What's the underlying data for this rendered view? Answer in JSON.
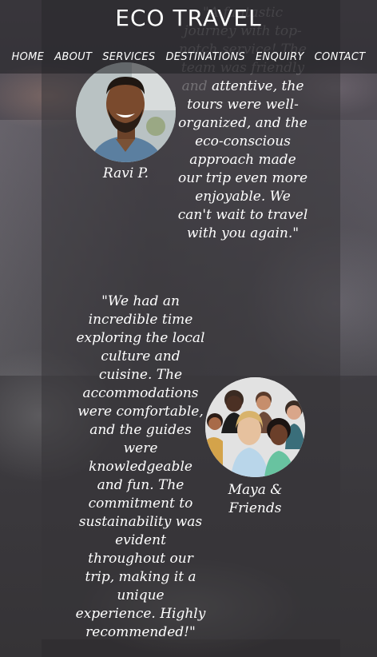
{
  "header": {
    "brand": "ECO TRAVEL",
    "nav": [
      "HOME",
      "ABOUT",
      "SERVICES",
      "DESTINATIONS",
      "ENQUIRY",
      "CONTACT"
    ]
  },
  "testimonials": [
    {
      "hidden_lines": "\"A fantastic journey with top-notch service! The team was friendly and",
      "text": "attentive, the tours were well-organized, and the eco-conscious approach made our trip even more enjoyable. We can't wait to travel with you again.\"",
      "name": "Ravi P.",
      "avatar_icon": "person-photo-icon"
    },
    {
      "text": "\"We had an incredible time exploring the local culture and cuisine. The accommodations were comfortable, and the guides were knowledgeable and fun. The commitment to sustainability was evident throughout our trip, making it a unique experience. Highly recommended!\"",
      "name": "Maya & Friends",
      "avatar_icon": "group-photo-icon"
    }
  ]
}
